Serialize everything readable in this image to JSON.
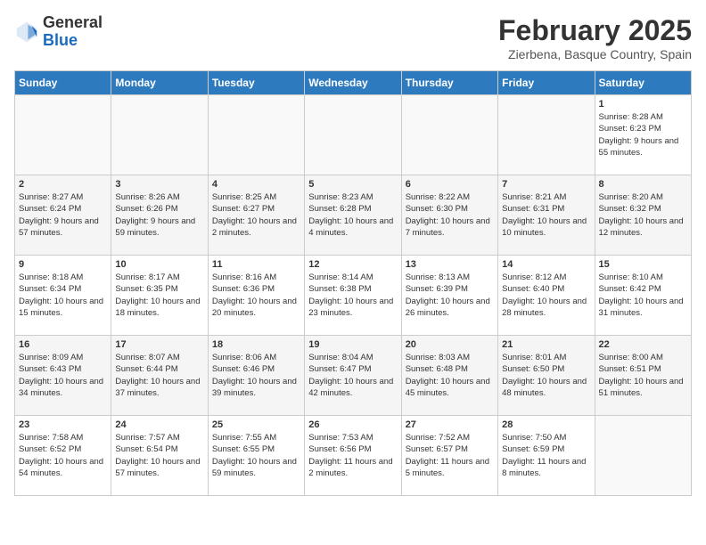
{
  "header": {
    "logo_general": "General",
    "logo_blue": "Blue",
    "title": "February 2025",
    "subtitle": "Zierbena, Basque Country, Spain"
  },
  "days_of_week": [
    "Sunday",
    "Monday",
    "Tuesday",
    "Wednesday",
    "Thursday",
    "Friday",
    "Saturday"
  ],
  "weeks": [
    [
      {
        "day": "",
        "info": ""
      },
      {
        "day": "",
        "info": ""
      },
      {
        "day": "",
        "info": ""
      },
      {
        "day": "",
        "info": ""
      },
      {
        "day": "",
        "info": ""
      },
      {
        "day": "",
        "info": ""
      },
      {
        "day": "1",
        "info": "Sunrise: 8:28 AM\nSunset: 6:23 PM\nDaylight: 9 hours and 55 minutes."
      }
    ],
    [
      {
        "day": "2",
        "info": "Sunrise: 8:27 AM\nSunset: 6:24 PM\nDaylight: 9 hours and 57 minutes."
      },
      {
        "day": "3",
        "info": "Sunrise: 8:26 AM\nSunset: 6:26 PM\nDaylight: 9 hours and 59 minutes."
      },
      {
        "day": "4",
        "info": "Sunrise: 8:25 AM\nSunset: 6:27 PM\nDaylight: 10 hours and 2 minutes."
      },
      {
        "day": "5",
        "info": "Sunrise: 8:23 AM\nSunset: 6:28 PM\nDaylight: 10 hours and 4 minutes."
      },
      {
        "day": "6",
        "info": "Sunrise: 8:22 AM\nSunset: 6:30 PM\nDaylight: 10 hours and 7 minutes."
      },
      {
        "day": "7",
        "info": "Sunrise: 8:21 AM\nSunset: 6:31 PM\nDaylight: 10 hours and 10 minutes."
      },
      {
        "day": "8",
        "info": "Sunrise: 8:20 AM\nSunset: 6:32 PM\nDaylight: 10 hours and 12 minutes."
      }
    ],
    [
      {
        "day": "9",
        "info": "Sunrise: 8:18 AM\nSunset: 6:34 PM\nDaylight: 10 hours and 15 minutes."
      },
      {
        "day": "10",
        "info": "Sunrise: 8:17 AM\nSunset: 6:35 PM\nDaylight: 10 hours and 18 minutes."
      },
      {
        "day": "11",
        "info": "Sunrise: 8:16 AM\nSunset: 6:36 PM\nDaylight: 10 hours and 20 minutes."
      },
      {
        "day": "12",
        "info": "Sunrise: 8:14 AM\nSunset: 6:38 PM\nDaylight: 10 hours and 23 minutes."
      },
      {
        "day": "13",
        "info": "Sunrise: 8:13 AM\nSunset: 6:39 PM\nDaylight: 10 hours and 26 minutes."
      },
      {
        "day": "14",
        "info": "Sunrise: 8:12 AM\nSunset: 6:40 PM\nDaylight: 10 hours and 28 minutes."
      },
      {
        "day": "15",
        "info": "Sunrise: 8:10 AM\nSunset: 6:42 PM\nDaylight: 10 hours and 31 minutes."
      }
    ],
    [
      {
        "day": "16",
        "info": "Sunrise: 8:09 AM\nSunset: 6:43 PM\nDaylight: 10 hours and 34 minutes."
      },
      {
        "day": "17",
        "info": "Sunrise: 8:07 AM\nSunset: 6:44 PM\nDaylight: 10 hours and 37 minutes."
      },
      {
        "day": "18",
        "info": "Sunrise: 8:06 AM\nSunset: 6:46 PM\nDaylight: 10 hours and 39 minutes."
      },
      {
        "day": "19",
        "info": "Sunrise: 8:04 AM\nSunset: 6:47 PM\nDaylight: 10 hours and 42 minutes."
      },
      {
        "day": "20",
        "info": "Sunrise: 8:03 AM\nSunset: 6:48 PM\nDaylight: 10 hours and 45 minutes."
      },
      {
        "day": "21",
        "info": "Sunrise: 8:01 AM\nSunset: 6:50 PM\nDaylight: 10 hours and 48 minutes."
      },
      {
        "day": "22",
        "info": "Sunrise: 8:00 AM\nSunset: 6:51 PM\nDaylight: 10 hours and 51 minutes."
      }
    ],
    [
      {
        "day": "23",
        "info": "Sunrise: 7:58 AM\nSunset: 6:52 PM\nDaylight: 10 hours and 54 minutes."
      },
      {
        "day": "24",
        "info": "Sunrise: 7:57 AM\nSunset: 6:54 PM\nDaylight: 10 hours and 57 minutes."
      },
      {
        "day": "25",
        "info": "Sunrise: 7:55 AM\nSunset: 6:55 PM\nDaylight: 10 hours and 59 minutes."
      },
      {
        "day": "26",
        "info": "Sunrise: 7:53 AM\nSunset: 6:56 PM\nDaylight: 11 hours and 2 minutes."
      },
      {
        "day": "27",
        "info": "Sunrise: 7:52 AM\nSunset: 6:57 PM\nDaylight: 11 hours and 5 minutes."
      },
      {
        "day": "28",
        "info": "Sunrise: 7:50 AM\nSunset: 6:59 PM\nDaylight: 11 hours and 8 minutes."
      },
      {
        "day": "",
        "info": ""
      }
    ]
  ]
}
